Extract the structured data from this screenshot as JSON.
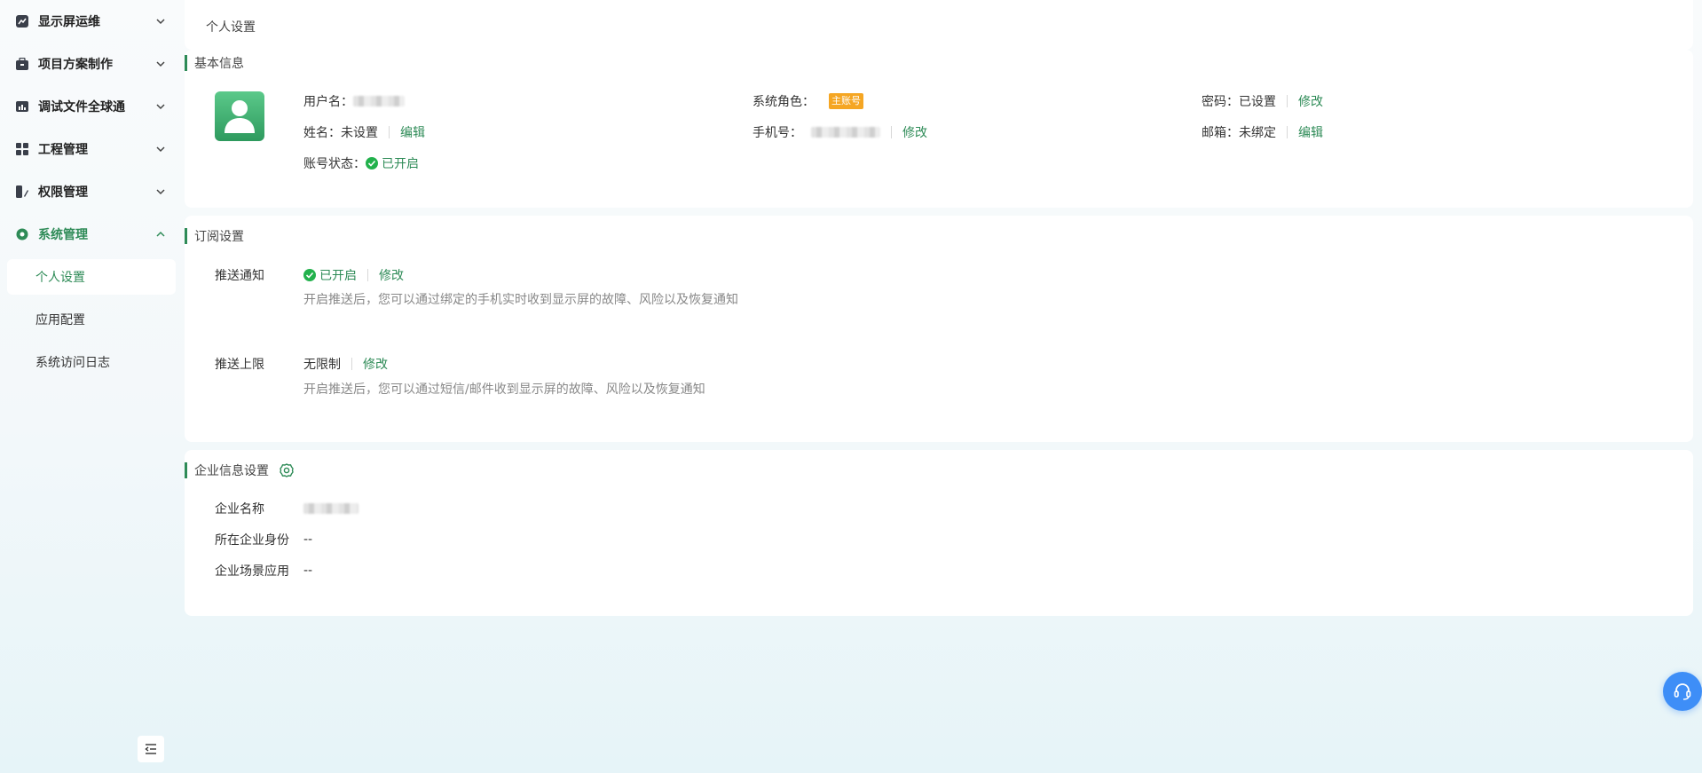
{
  "sidebar": {
    "menu": [
      {
        "label": "显示屏运维",
        "icon": "trend-chart-icon",
        "expanded": false
      },
      {
        "label": "项目方案制作",
        "icon": "briefcase-icon",
        "expanded": false
      },
      {
        "label": "调试文件全球通",
        "icon": "bar-chart-icon",
        "expanded": false
      },
      {
        "label": "工程管理",
        "icon": "grid-icon",
        "expanded": false
      },
      {
        "label": "权限管理",
        "icon": "permission-icon",
        "expanded": false
      },
      {
        "label": "系统管理",
        "icon": "system-dot-icon",
        "expanded": true
      }
    ],
    "submenu": [
      {
        "label": "个人设置",
        "active": true
      },
      {
        "label": "应用配置",
        "active": false
      },
      {
        "label": "系统访问日志",
        "active": false
      }
    ]
  },
  "page": {
    "title": "个人设置"
  },
  "basic": {
    "title": "基本信息",
    "username_label": "用户名：",
    "role_label": "系统角色：",
    "role_badge": "主账号",
    "password_label": "密码：",
    "password_value": "已设置",
    "password_action": "修改",
    "name_label": "姓名：",
    "name_value": "未设置",
    "name_action": "编辑",
    "phone_label": "手机号：",
    "phone_action": "修改",
    "email_label": "邮箱：",
    "email_value": "未绑定",
    "email_action": "编辑",
    "status_label": "账号状态：",
    "status_value": "已开启"
  },
  "subscription": {
    "title": "订阅设置",
    "push_label": "推送通知",
    "push_status": "已开启",
    "push_action": "修改",
    "push_desc": "开启推送后，您可以通过绑定的手机实时收到显示屏的故障、风险以及恢复通知",
    "limit_label": "推送上限",
    "limit_value": "无限制",
    "limit_action": "修改",
    "limit_desc": "开启推送后，您可以通过短信/邮件收到显示屏的故障、风险以及恢复通知"
  },
  "enterprise": {
    "title": "企业信息设置",
    "name_label": "企业名称",
    "identity_label": "所在企业身份",
    "identity_value": "--",
    "scene_label": "企业场景应用",
    "scene_value": "--"
  },
  "colors": {
    "accent": "#2e8b57",
    "badge": "#f5a623",
    "float": "#3e8ef7"
  }
}
